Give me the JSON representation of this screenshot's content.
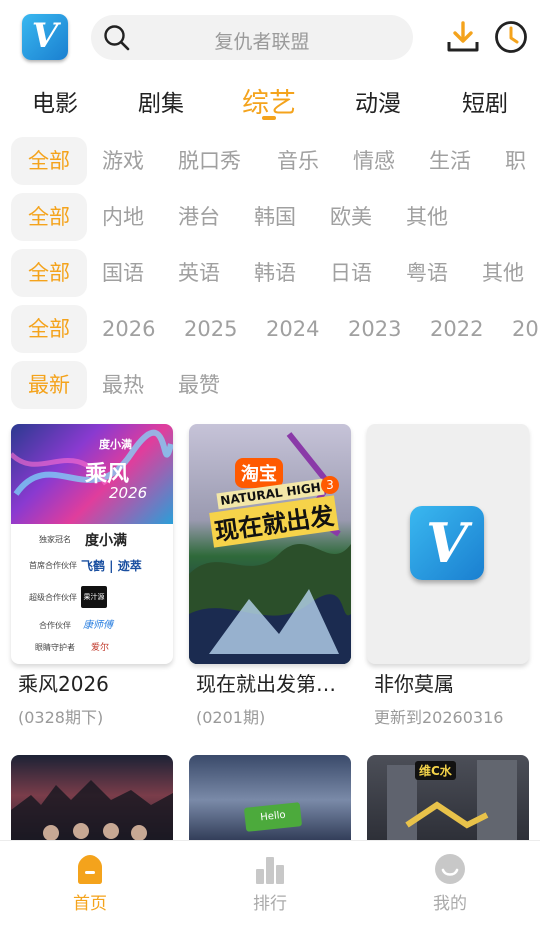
{
  "header": {
    "logo_letter": "V",
    "search_placeholder": "复仇者联盟",
    "icons": [
      "search-icon",
      "download-icon",
      "history-clock-icon"
    ]
  },
  "tabs": [
    {
      "label": "电影",
      "active": false
    },
    {
      "label": "剧集",
      "active": false
    },
    {
      "label": "综艺",
      "active": true
    },
    {
      "label": "动漫",
      "active": false
    },
    {
      "label": "短剧",
      "active": false
    }
  ],
  "filters": {
    "genre": {
      "selected": "全部",
      "options": [
        "游戏",
        "脱口秀",
        "音乐",
        "情感",
        "生活",
        "职"
      ]
    },
    "region": {
      "selected": "全部",
      "options": [
        "内地",
        "港台",
        "韩国",
        "欧美",
        "其他"
      ]
    },
    "language": {
      "selected": "全部",
      "options": [
        "国语",
        "英语",
        "韩语",
        "日语",
        "粤语",
        "其他"
      ]
    },
    "year": {
      "selected": "全部",
      "options": [
        "2026",
        "2025",
        "2024",
        "2023",
        "2022",
        "20"
      ]
    },
    "sort": {
      "selected": "最新",
      "options": [
        "最热",
        "最赞"
      ]
    }
  },
  "cards": [
    {
      "title": "乘风2026",
      "subtitle": "(0328期下)",
      "poster": {
        "badge": "度小满",
        "big": "乘风",
        "year": "2026",
        "sponsors": [
          {
            "label": "独家冠名",
            "brand": "度小满"
          },
          {
            "label": "首席合作伙伴",
            "brand": "飞鹤 | 迹萃"
          },
          {
            "label": "超级合作伙伴",
            "brand": "果汁源"
          },
          {
            "label": "合作伙伴",
            "brand": "康师傅"
          },
          {
            "label": "眼睛守护者",
            "brand": "爱尔"
          }
        ]
      }
    },
    {
      "title": "现在就出发第…",
      "subtitle": "(0201期)",
      "poster": {
        "tag": "淘宝",
        "en": "NATURAL HIGH",
        "big": "现在就出发",
        "season": "3"
      }
    },
    {
      "title": "非你莫属",
      "subtitle": "更新到20260316",
      "poster": {
        "placeholder_logo": "V"
      }
    }
  ],
  "row2_posters": [
    {
      "name": "poster-dark-city"
    },
    {
      "name": "poster-blue-stage",
      "text": "Hello"
    },
    {
      "name": "poster-building",
      "badge": "维C水"
    }
  ],
  "bottom_nav": [
    {
      "label": "首页",
      "icon": "home-icon",
      "active": true
    },
    {
      "label": "排行",
      "icon": "bar-chart-icon",
      "active": false
    },
    {
      "label": "我的",
      "icon": "smiley-icon",
      "active": false
    }
  ],
  "colors": {
    "accent": "#f4a31c",
    "text": "#222222",
    "muted": "#a0a0a0",
    "chip_bg": "#f3f3f3"
  }
}
